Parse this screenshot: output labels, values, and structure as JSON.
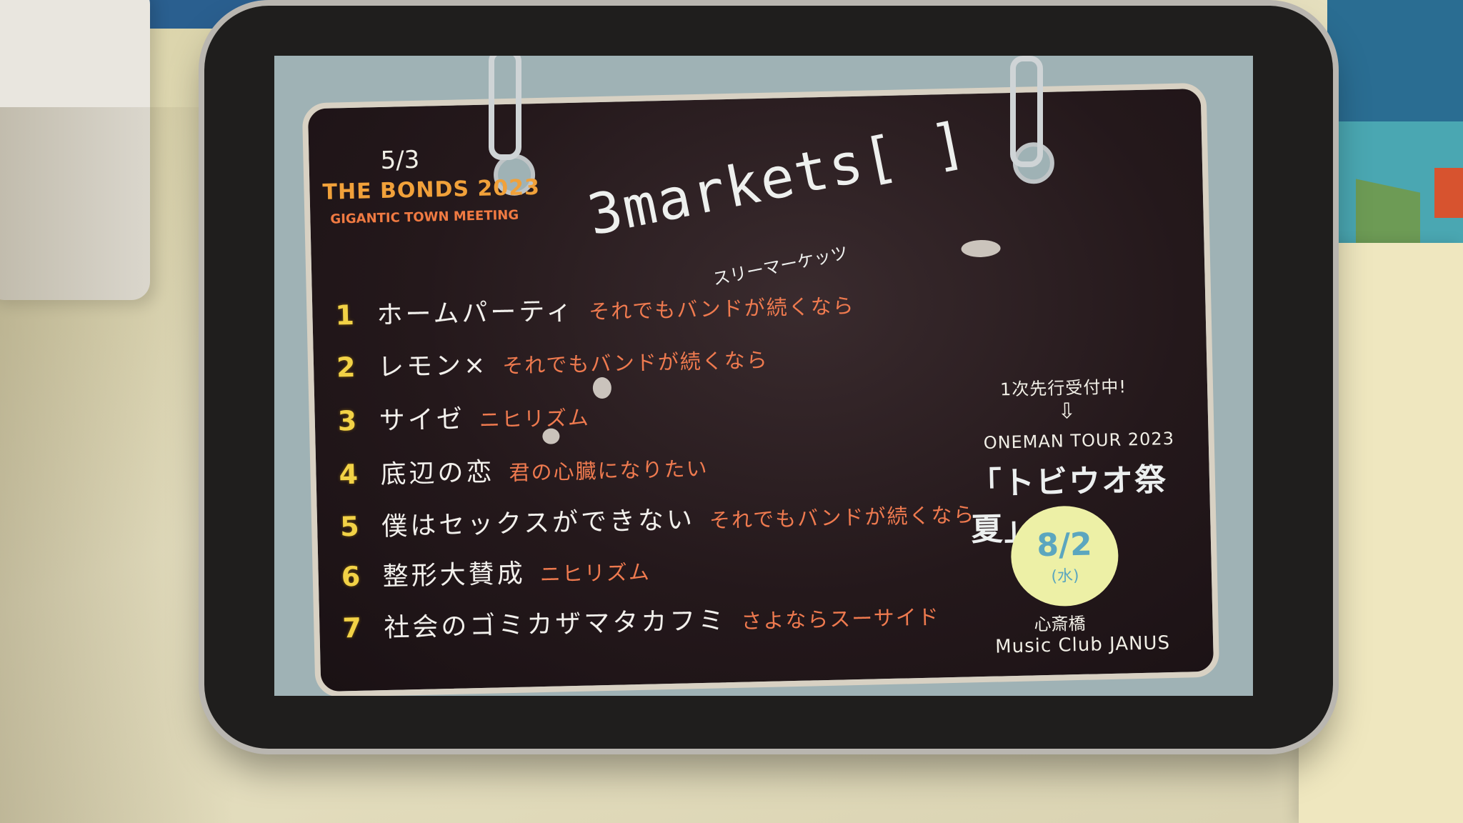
{
  "board": {
    "date": "5/3",
    "event_title": "THE BONDS 2023",
    "event_subtitle": "GIGANTIC TOWN MEETING",
    "band_name": "3markets[ ]",
    "band_kana": "スリーマーケッツ",
    "setlist": [
      {
        "number": "1",
        "title": "ホームパーティ",
        "album": "それでもバンドが続くなら"
      },
      {
        "number": "2",
        "title": "レモン×",
        "album": "それでもバンドが続くなら"
      },
      {
        "number": "3",
        "title": "サイゼ",
        "album": "ニヒリズム"
      },
      {
        "number": "4",
        "title": "底辺の恋",
        "album": "君の心臓になりたい"
      },
      {
        "number": "5",
        "title": "僕はセックスができない",
        "album": "それでもバンドが続くなら"
      },
      {
        "number": "6",
        "title": "整形大賛成",
        "album": "ニヒリズム"
      },
      {
        "number": "7",
        "title": "社会のゴミカザマタカフミ",
        "album": "さよならスーサイド"
      }
    ],
    "presale_text": "1次先行受付中!",
    "arrow": "⇩",
    "tour_label": "ONEMAN TOUR 2023",
    "tour_name": "「トビウオ祭 夏」",
    "tour_date": "8/2",
    "tour_day": "(水)",
    "venue_area": "心斎橋",
    "venue_name": "Music Club JANUS"
  }
}
